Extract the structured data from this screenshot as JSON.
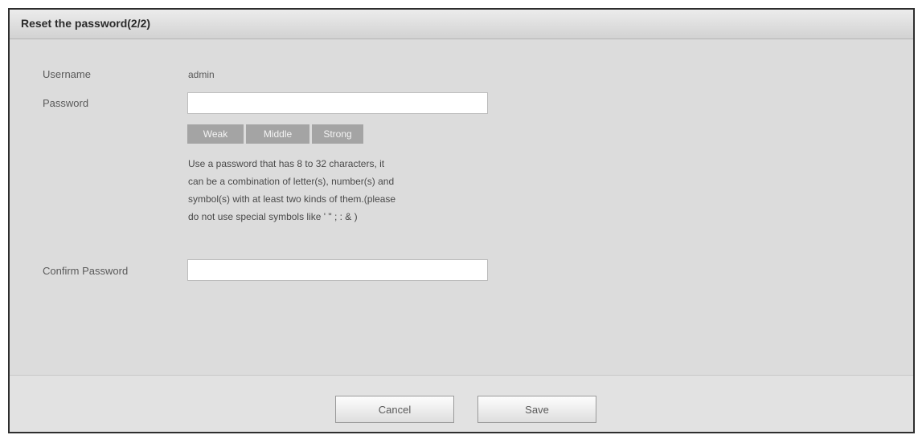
{
  "dialog": {
    "title": "Reset the password(2/2)"
  },
  "form": {
    "username": {
      "label": "Username",
      "value": "admin"
    },
    "password": {
      "label": "Password",
      "value": ""
    },
    "strength": {
      "levels": [
        "Weak",
        "Middle",
        "Strong"
      ]
    },
    "hint_lines": [
      "Use a password that has 8 to 32 characters, it",
      "can be a combination of letter(s), number(s) and",
      "symbol(s) with at least two kinds of them.(please",
      "do not use special symbols like ' \" ; : & )"
    ],
    "confirm_password": {
      "label": "Confirm Password",
      "value": ""
    }
  },
  "footer": {
    "cancel_label": "Cancel",
    "save_label": "Save"
  },
  "colors": {
    "background": "#dcdcdc",
    "strength_bar": "#a4a4a4",
    "border": "#2e2e2e"
  }
}
